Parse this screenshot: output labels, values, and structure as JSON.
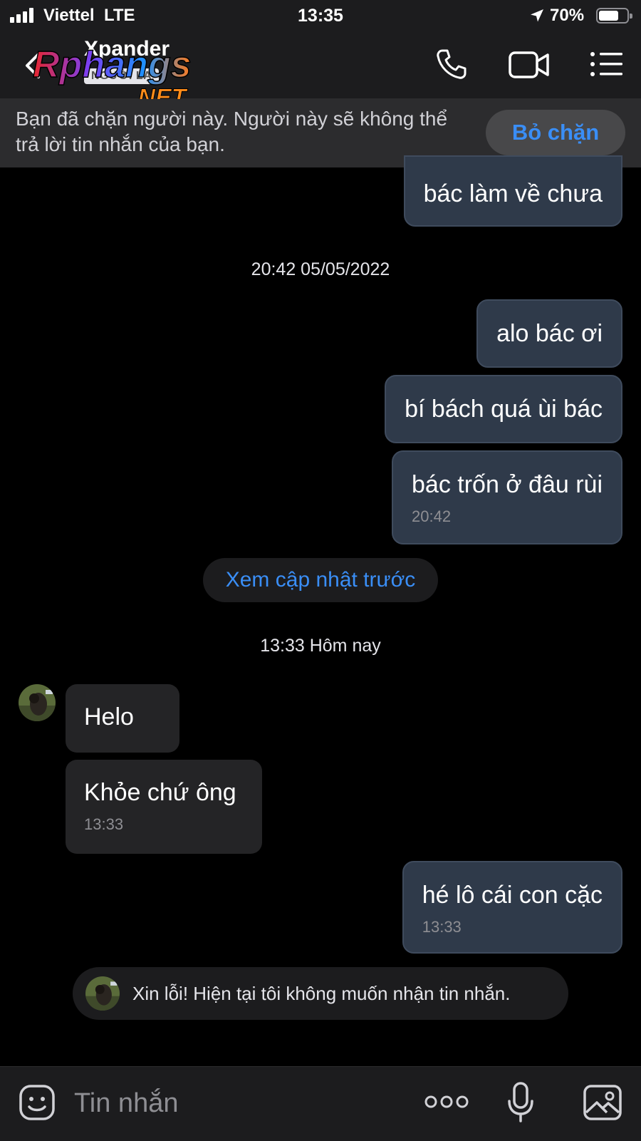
{
  "status_bar": {
    "carrier": "Viettel",
    "network": "LTE",
    "time": "13:35",
    "battery": "70%",
    "battery_level": 0.7
  },
  "header": {
    "contact_name": "Xpander",
    "stranger_badge": "NGƯỜI LẠ",
    "watermark_text": "Rphangs .NET",
    "icons": [
      "back-icon",
      "call-icon",
      "video-call-icon",
      "menu-icon"
    ]
  },
  "blocked_banner": {
    "text": "Bạn đã chặn người này. Người này sẽ không thể trả lời tin nhắn của bạn.",
    "unblock_label": "Bỏ chặn"
  },
  "conversation": {
    "messages_before": [
      {
        "text": "bác làm về chưa",
        "direction": "outgoing"
      }
    ],
    "date_1": "20:42 05/05/2022",
    "messages_group_1": [
      {
        "text": "alo bác ơi",
        "direction": "outgoing"
      },
      {
        "text": "bí bách quá ùi bác",
        "direction": "outgoing"
      },
      {
        "text": "bác trốn ở đâu rùi",
        "direction": "outgoing",
        "time": "20:42"
      }
    ],
    "earlier_updates_label": "Xem cập nhật trước",
    "date_2": "13:33 Hôm nay",
    "messages_group_2": [
      {
        "text": "Helo",
        "direction": "incoming"
      },
      {
        "text": "Khỏe chứ ông",
        "direction": "incoming",
        "time": "13:33"
      },
      {
        "text": "hé lô cái con cặc",
        "direction": "outgoing",
        "time": "13:33"
      }
    ],
    "auto_reply": "Xin lỗi! Hiện tại tôi không muốn nhận tin nhắn."
  },
  "input_bar": {
    "placeholder": "Tin nhắn",
    "icons": [
      "sticker-icon",
      "more-icon",
      "mic-icon",
      "image-icon"
    ]
  },
  "colors": {
    "accent": "#3a8ef6",
    "outgoing_bubble": "#2f3a4a",
    "incoming_bubble": "#242426",
    "background": "#000000"
  }
}
